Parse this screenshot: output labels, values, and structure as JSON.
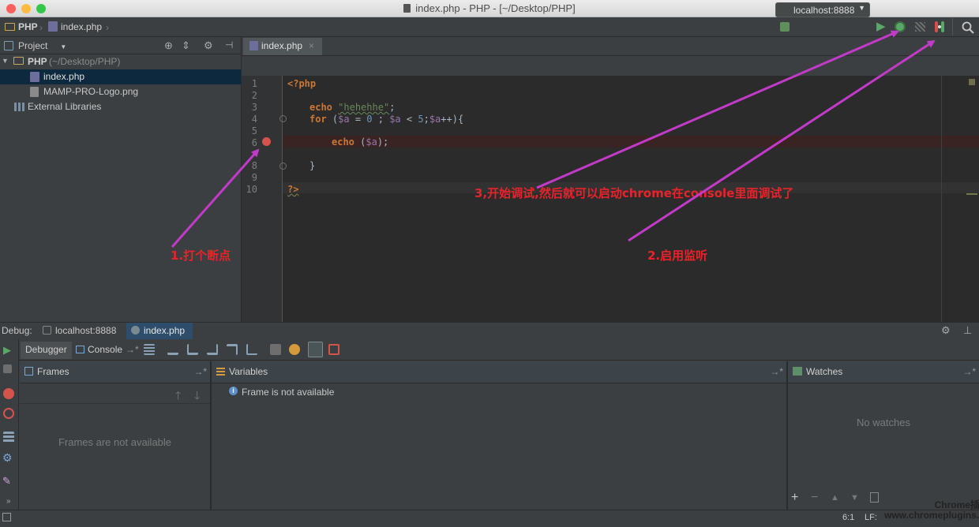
{
  "window": {
    "title": "index.php - PHP - [~/Desktop/PHP]"
  },
  "navbar": {
    "crumb_project": "PHP",
    "crumb_file": "index.php",
    "run_config": "localhost:8888"
  },
  "project_panel": {
    "title": "Project",
    "root_name": "PHP",
    "root_path": "(~/Desktop/PHP)",
    "files": [
      "index.php",
      "MAMP-PRO-Logo.png"
    ],
    "external": "External Libraries"
  },
  "editor": {
    "tab_label": "index.php",
    "line_numbers": [
      "1",
      "2",
      "3",
      "4",
      "5",
      "6",
      "8",
      "9",
      "10"
    ],
    "code": {
      "open_tag": "<?php",
      "echo_kw": "echo",
      "echo_str": "\"hehehhe\"",
      "semicolon": ";",
      "for_kw": "for",
      "for_open": " (",
      "for_var1": "$a",
      "for_eq": " = ",
      "for_zero": "0",
      "for_sep1": " ; ",
      "for_var2": "$a",
      "for_lt": " < ",
      "for_five": "5",
      "for_sep2": ";",
      "for_var3": "$a",
      "for_inc": "++){",
      "echo2_kw": "echo",
      "echo2_open": " (",
      "echo2_var": "$a",
      "echo2_close": ");",
      "close_brace": "}",
      "close_tag": "?>"
    }
  },
  "annotations": {
    "step1": "1.打个断点",
    "step2": "2.启用监听",
    "step3": "3,开始调试,然后就可以启动chrome在console里面调试了"
  },
  "debug": {
    "label": "Debug:",
    "tabs": [
      "localhost:8888",
      "index.php"
    ],
    "subtabs": [
      "Debugger",
      "Console"
    ],
    "frames_title": "Frames",
    "frames_empty": "Frames are not available",
    "variables_title": "Variables",
    "variables_msg": "Frame is not available",
    "watches_title": "Watches",
    "watches_empty": "No watches"
  },
  "statusbar": {
    "position": "6:1",
    "line_sep": "LF:"
  },
  "watermark": {
    "line1": "Chrome插件网",
    "line2": "www.chromeplugins.com"
  },
  "colors": {
    "accent": "#2d4d6a",
    "breakpoint": "#d4544c",
    "annotation": "#e8232a",
    "arrow": "#c23bc8"
  }
}
